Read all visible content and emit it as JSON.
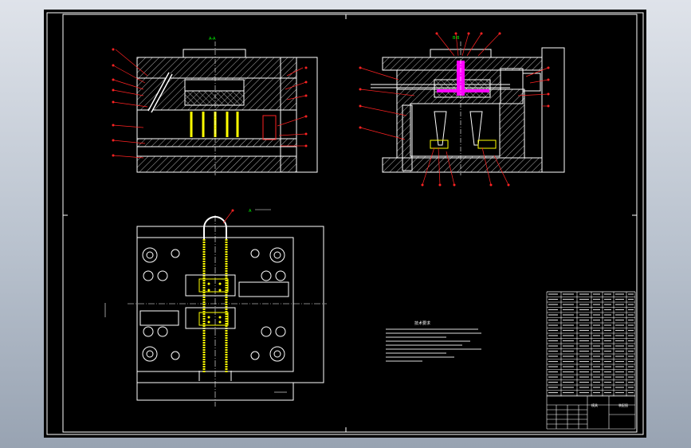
{
  "viewer": {
    "background_top": "#dfe3ea",
    "background_bottom": "#98a3b2",
    "canvas_color": "#000000",
    "line_color": "#ffffff",
    "leader_color": "#ff2020",
    "dim_color": "#00ff00",
    "part_color": "#ffff00",
    "runner_color": "#ff00ff"
  },
  "drawing": {
    "notes_title": "技术要求",
    "view_section_label_a": "A-A",
    "view_section_label_b": "B-B",
    "view_plan_label": "A",
    "title_block_name": "模具",
    "title_block_drawing_no": "装配图"
  }
}
